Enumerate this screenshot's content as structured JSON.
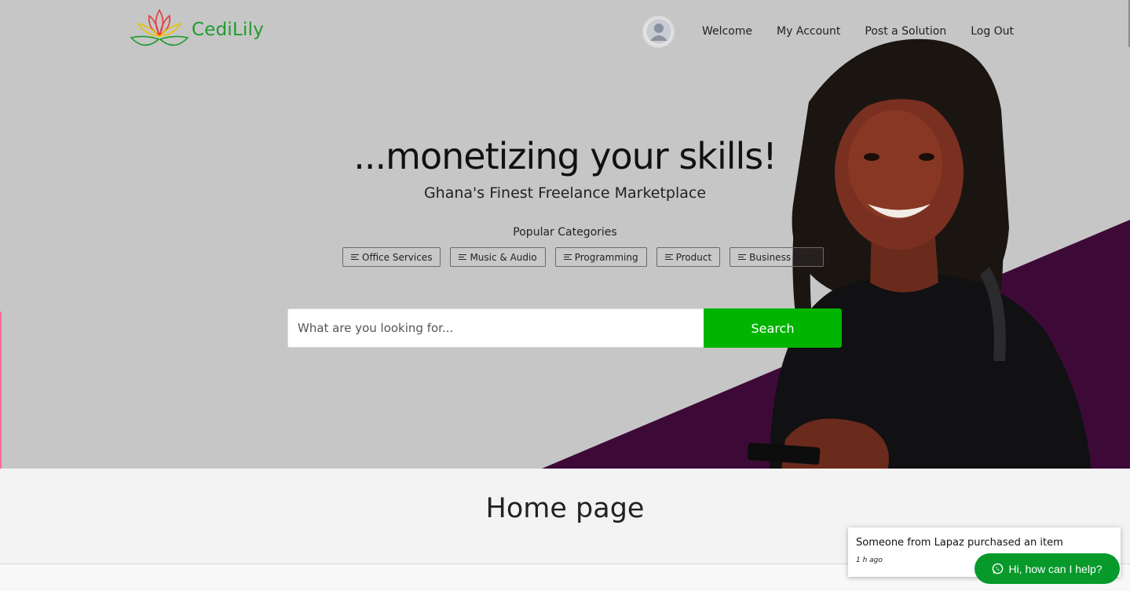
{
  "brand": {
    "name": "CediLily"
  },
  "nav": {
    "links": [
      "Welcome",
      "My Account",
      "Post a Solution",
      "Log Out"
    ]
  },
  "hero": {
    "headline": "...monetizing your skills!",
    "subheadline": "Ghana's Finest Freelance Marketplace",
    "popular_label": "Popular Categories",
    "categories": [
      "Office Services",
      "Music & Audio",
      "Programming",
      "Product",
      "Business Type"
    ]
  },
  "search": {
    "placeholder": "What are you looking for...",
    "button_label": "Search"
  },
  "main": {
    "title": "Home page"
  },
  "notification": {
    "message": "Someone from Lapaz purchased an item",
    "time": "1 h ago"
  },
  "chat": {
    "label": "Hi, how can I help?"
  },
  "colors": {
    "accent_green": "#00b400",
    "chat_green": "#079a2b",
    "hero_purple": "#3d0a38",
    "hero_bg": "#c6c6c6"
  }
}
